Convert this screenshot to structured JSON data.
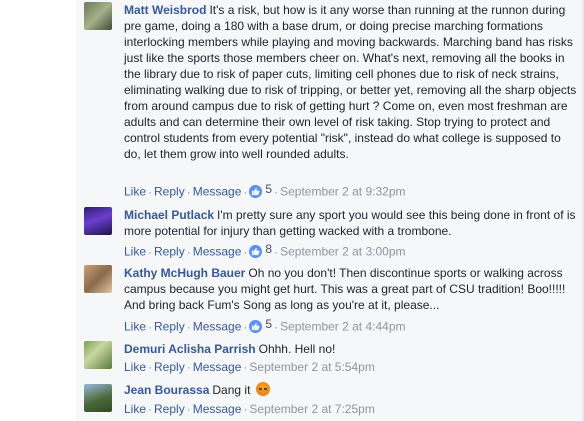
{
  "comments": [
    {
      "author": "Matt Weisbrod",
      "text": "It's a risk, but how is it any worse than running at the runnon during pre game, doing a 180 with a base drum, or doing precise marching formations interlocking members while playing and moving backwards. Marching band has risks just like the sports those members cheer on. What's next, removing all the books in the library due to risk of paper cuts, limiting cell phones due to risk of neck strains, eliminating walking due to risk of tripping, or better yet, removing all the sharp objects from around campus due to risk of getting hurt ? Come on, even most freshman are adults and can determine their own level of risk taking. Stop trying to protect and control students from every potential \"risk\", instead do what college is supposed to do, let them grow into well rounded adults.",
      "like": "Like",
      "reply": "Reply",
      "message": "Message",
      "likes": "5",
      "time": "September 2 at 9:32pm"
    },
    {
      "author": "Michael Putlack",
      "text": "I'm pretty sure any sport you would see this being done in front of is more potential for injury than getting wacked with a trombone.",
      "like": "Like",
      "reply": "Reply",
      "message": "Message",
      "likes": "8",
      "time": "September 2 at 3:00pm"
    },
    {
      "author": "Kathy McHugh Bauer",
      "text": "Oh no you don't! Then discontinue sports or walking across campus because you might get hurt. This was a great part of CSU tradition! Boo!!!!! And bring back Fum's Song as long as you're at it, please...",
      "like": "Like",
      "reply": "Reply",
      "message": "Message",
      "likes": "5",
      "time": "September 2 at 4:44pm"
    },
    {
      "author": "Demuri Aclisha Parrish",
      "text": "Ohhh. Hell no!",
      "like": "Like",
      "reply": "Reply",
      "message": "Message",
      "time": "September 2 at 5:54pm"
    },
    {
      "author": "Jean Bourassa",
      "text": "Dang it",
      "emoji": "angry-face-icon",
      "like": "Like",
      "reply": "Reply",
      "message": "Message",
      "time": "September 2 at 7:25pm"
    }
  ],
  "colors": {
    "author_link": "#365899",
    "text": "#1d2129",
    "meta": "#90949c",
    "like_badge": "#5890ff",
    "panel": "#f6f7f9"
  }
}
